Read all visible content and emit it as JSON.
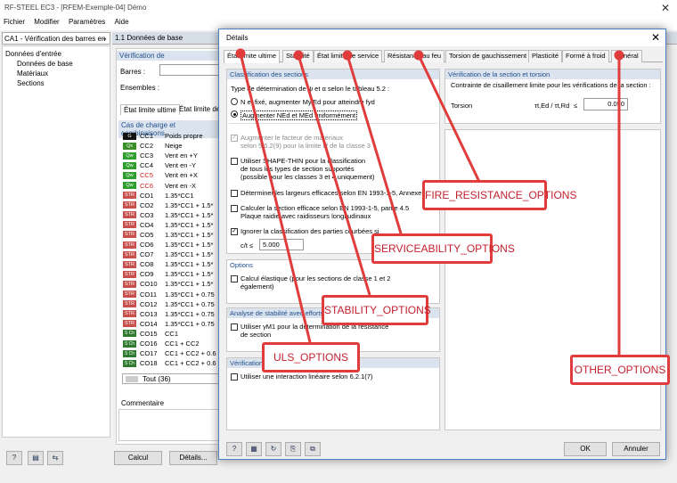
{
  "app": {
    "title": "RF-STEEL EC3 - [RFEM-Exemple-04] Démo",
    "close_glyph": "✕",
    "menu": [
      "Fichier",
      "Modifier",
      "Paramètres",
      "Aide"
    ],
    "case_selector": "CA1 - Vérification des barres en",
    "section_title": "1.1 Données de base"
  },
  "nav": {
    "root": "Données d'entrée",
    "items": [
      "Données de base",
      "Matériaux",
      "Sections"
    ]
  },
  "main": {
    "verification_label": "Vérification de",
    "bars_label": "Barres :",
    "sets_label": "Ensembles :",
    "tab_uls": "État limite ultime",
    "tab_sls": "État limite de",
    "cases_header": "Cas de charge et combinaisons",
    "load_cases": [
      {
        "badge": "G",
        "id": "CC1",
        "desc": "Poids propre",
        "type": "G"
      },
      {
        "badge": "Qs",
        "id": "CC2",
        "desc": "Neige",
        "type": "Qs"
      },
      {
        "badge": "Qw",
        "id": "CC3",
        "desc": "Vent en +Y",
        "type": "Qw"
      },
      {
        "badge": "Qw",
        "id": "CC4",
        "desc": "Vent en -Y",
        "type": "Qw"
      },
      {
        "badge": "Qw",
        "id": "CC5",
        "desc": "Vent en +X",
        "type": "Qw",
        "red": true
      },
      {
        "badge": "Qw",
        "id": "CC6",
        "desc": "Vent en -X",
        "type": "Qw",
        "red": true
      },
      {
        "badge": "STR",
        "id": "CO1",
        "desc": "1.35*CC1",
        "type": "STR"
      },
      {
        "badge": "STR",
        "id": "CO2",
        "desc": "1.35*CC1 + 1.5*",
        "type": "STR"
      },
      {
        "badge": "STR",
        "id": "CO3",
        "desc": "1.35*CC1 + 1.5*",
        "type": "STR"
      },
      {
        "badge": "STR",
        "id": "CO4",
        "desc": "1.35*CC1 + 1.5*",
        "type": "STR"
      },
      {
        "badge": "STR",
        "id": "CO5",
        "desc": "1.35*CC1 + 1.5*",
        "type": "STR"
      },
      {
        "badge": "STR",
        "id": "CO6",
        "desc": "1.35*CC1 + 1.5*",
        "type": "STR"
      },
      {
        "badge": "STR",
        "id": "CO7",
        "desc": "1.35*CC1 + 1.5*",
        "type": "STR"
      },
      {
        "badge": "STR",
        "id": "CO8",
        "desc": "1.35*CC1 + 1.5*",
        "type": "STR"
      },
      {
        "badge": "STR",
        "id": "CO9",
        "desc": "1.35*CC1 + 1.5*",
        "type": "STR"
      },
      {
        "badge": "STR",
        "id": "CO10",
        "desc": "1.35*CC1 + 1.5*",
        "type": "STR"
      },
      {
        "badge": "STR",
        "id": "CO11",
        "desc": "1.35*CC1 + 0.75",
        "type": "STR"
      },
      {
        "badge": "STR",
        "id": "CO12",
        "desc": "1.35*CC1 + 0.75",
        "type": "STR"
      },
      {
        "badge": "STR",
        "id": "CO13",
        "desc": "1.35*CC1 + 0.75",
        "type": "STR"
      },
      {
        "badge": "STR",
        "id": "CO14",
        "desc": "1.35*CC1 + 0.75",
        "type": "STR"
      },
      {
        "badge": "S Ch",
        "id": "CO15",
        "desc": "CC1",
        "type": "SCh"
      },
      {
        "badge": "S Ch",
        "id": "CO16",
        "desc": "CC1 + CC2",
        "type": "SCh"
      },
      {
        "badge": "S Ch",
        "id": "CO17",
        "desc": "CC1 + CC2 + 0.6",
        "type": "SCh"
      },
      {
        "badge": "S Ch",
        "id": "CO18",
        "desc": "CC1 + CC2 + 0.6",
        "type": "SCh"
      }
    ],
    "all_label": "Tout (36)",
    "comment_label": "Commentaire"
  },
  "bottom": {
    "calc_button": "Calcul",
    "details_button": "Détails..."
  },
  "dialog": {
    "title": "Détails",
    "close_glyph": "✕",
    "tabs": [
      "État limite ultime",
      "Stabilité",
      "État limite de service",
      "Résistance au feu",
      "Torsion de gauchissement",
      "Plasticité",
      "Formé à froid",
      "Général"
    ],
    "classification": {
      "header": "Classification des sections",
      "type_label": "Type de détermination de ψ et α selon le tableau 5.2 :",
      "radio_fixed": "N et fixé, augmenter My,Ed pour atteindre fyd",
      "radio_uniform": "Augmenter NEd et MEd uniformément",
      "opt_increase_factor_1": "Augmenter le facteur de matériaux",
      "opt_increase_factor_2": "selon 5.5.2(9) pour la limite εf de la classe 3",
      "opt_shapethin_1": "Utiliser SHAPE-THIN pour la classification",
      "opt_shapethin_2": "de tous les types de section supportés",
      "opt_shapethin_3": "(possible pour les classes 3 et 4 uniquement)",
      "opt_effective_widths": "Déterminer les largeurs efficaces selon EN 1993-1-5, Annexe",
      "opt_calc_effective_1": "Calculer la section efficace selon EN 1993-1-5, partie 4.5",
      "opt_calc_effective_2": "Plaque raidie avec raidisseurs longitudinaux",
      "opt_ignore_curved": "Ignorer la classification des parties courbées si",
      "ct_label": "c/t ≤",
      "ct_value": "5.000"
    },
    "options": {
      "header": "Options",
      "opt_elastic_1": "Calcul élastique (pour les sections de classe 1 et 2",
      "opt_elastic_2": "également)"
    },
    "stability": {
      "header": "Analyse de stabilité avec efforts",
      "opt_gamma_1": "Utiliser γM1 pour la détermination de la résistance",
      "opt_gamma_2": "de section"
    },
    "verification": {
      "header": "Vérification",
      "opt_linear": "Utiliser une interaction linéaire selon 6.2.1(7)"
    },
    "torsion": {
      "header": "Vérification de la section et torsion",
      "desc": "Contrainte de cisaillement limite pour les vérifications de la section :",
      "label": "Torsion",
      "formula": "τt,Ed / τt,Rd",
      "le": "≤",
      "value": "0.050"
    },
    "ok_button": "OK",
    "cancel_button": "Annuler"
  },
  "annotations": {
    "uls": "ULS_OPTIONS",
    "stability": "STABILITY_OPTIONS",
    "serviceability": "SERVICEABILITY_OPTIONS",
    "fire": "FIRE_RESISTANCE_OPTIONS",
    "other": "OTHER_OPTIONS"
  },
  "colors": {
    "annotation_red": "#e03c3c",
    "dialog_border": "#4a7fc1",
    "section_header_bg": "#dbe4ee"
  }
}
